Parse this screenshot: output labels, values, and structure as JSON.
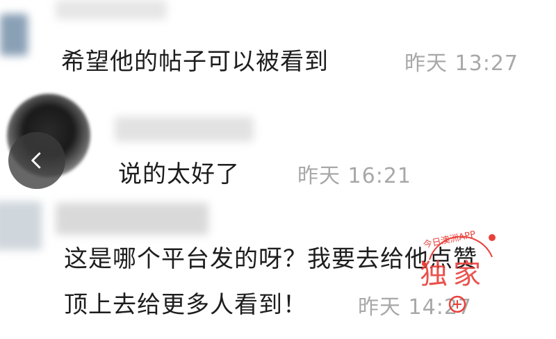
{
  "comments": [
    {
      "text": "希望他的帖子可以被看到",
      "time": "昨天 13:27"
    },
    {
      "text": "说的太好了",
      "time": "昨天 16:21"
    },
    {
      "line1": "这是哪个平台发的呀？我要去给他点赞",
      "line2": "顶上去给更多人看到！",
      "time": "昨天 14:27"
    }
  ],
  "watermark": {
    "brand": "今日澳洲APP",
    "label": "独家"
  },
  "icons": {
    "back": "chevron-left-icon"
  },
  "colors": {
    "text": "#1d1d1d",
    "timestamp": "#a8a8a8",
    "watermark": "#e8403a"
  }
}
